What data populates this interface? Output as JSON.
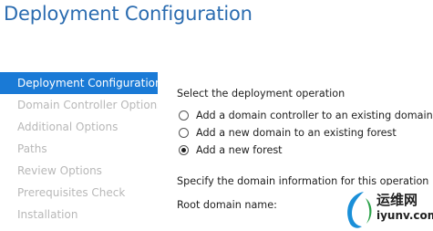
{
  "window": {
    "title": "Deployment Configuration"
  },
  "sidebar": {
    "items": [
      {
        "label": "Deployment Configuration",
        "active": true
      },
      {
        "label": "Domain Controller Options",
        "active": false
      },
      {
        "label": "Additional Options",
        "active": false
      },
      {
        "label": "Paths",
        "active": false
      },
      {
        "label": "Review Options",
        "active": false
      },
      {
        "label": "Prerequisites Check",
        "active": false
      },
      {
        "label": "Installation",
        "active": false
      }
    ]
  },
  "main": {
    "operation_heading": "Select the deployment operation",
    "options": [
      {
        "label": "Add a domain controller to an existing domain",
        "selected": false
      },
      {
        "label": "Add a new domain to an existing forest",
        "selected": false
      },
      {
        "label": "Add a new forest",
        "selected": true
      }
    ],
    "domain_heading": "Specify the domain information for this operation",
    "root_domain_label": "Root domain name:"
  },
  "watermark": {
    "brand": "运维网",
    "url": "iyunv.com"
  },
  "colors": {
    "accent": "#1a7ad6",
    "title": "#2b6cb0",
    "disabled_text": "#b8b8b8"
  }
}
